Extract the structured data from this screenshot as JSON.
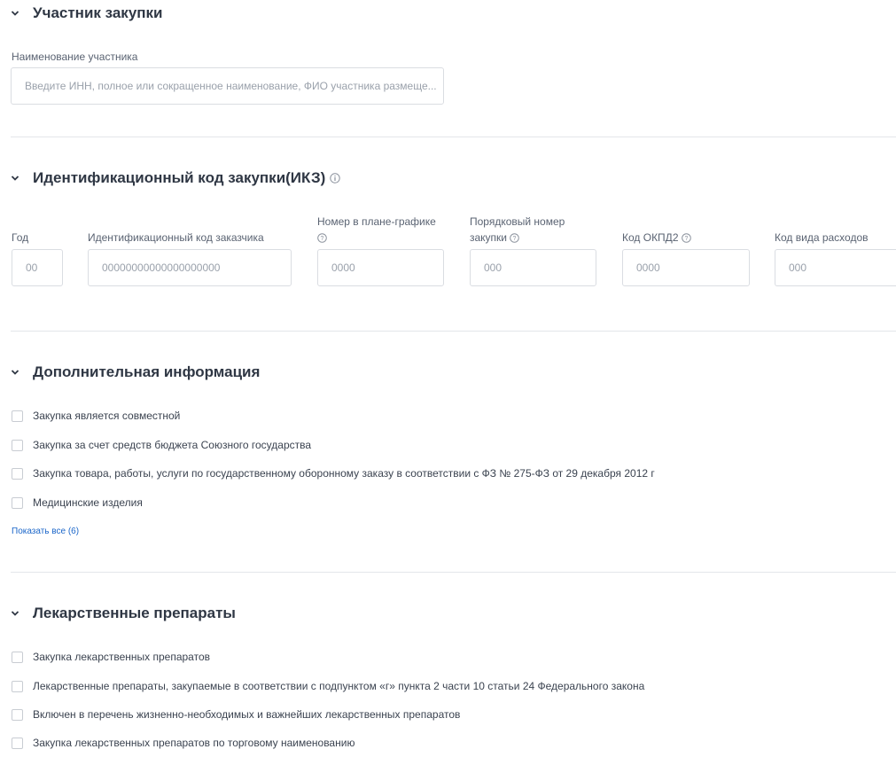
{
  "participant_section": {
    "title": "Участник закупки",
    "name_label": "Наименование участника",
    "name_placeholder": "Введите ИНН, полное или сокращенное наименование, ФИО участника размеще..."
  },
  "ikz_section": {
    "title": "Идентификационный код закупки(ИКЗ)",
    "fields": [
      {
        "label": "Год",
        "label_line2": "",
        "placeholder": "00"
      },
      {
        "label": "Идентификационный код заказчика",
        "label_line2": "",
        "placeholder": "00000000000000000000"
      },
      {
        "label": "Номер в плане-графике",
        "label_line2": "",
        "placeholder": "0000"
      },
      {
        "label": "Порядковый номер",
        "label_line2": "закупки",
        "placeholder": "000"
      },
      {
        "label": "Код ОКПД2",
        "label_line2": "",
        "placeholder": "0000"
      },
      {
        "label": "Код вида расходов",
        "label_line2": "",
        "placeholder": "000"
      }
    ]
  },
  "additional_section": {
    "title": "Дополнительная информация",
    "checkboxes": [
      "Закупка является совместной",
      "Закупка за счет средств бюджета Союзного государства",
      "Закупка товара, работы, услуги по государственному оборонному заказу в соответствии с ФЗ № 275-ФЗ от 29 декабря 2012 г",
      "Медицинские изделия"
    ],
    "show_all_label": "Показать все (6)"
  },
  "drugs_section": {
    "title": "Лекарственные препараты",
    "checkboxes": [
      "Закупка лекарственных препаратов",
      "Лекарственные препараты, закупаемые в соответствии с подпунктом «г» пункта 2 части 10 статьи 24 Федерального закона",
      "Включен в перечень жизненно-необходимых и важнейших лекарственных препаратов",
      "Закупка лекарственных препаратов по торговому наименованию"
    ]
  },
  "icons": {
    "chevron": "chevron-down-icon",
    "info": "info-circle-icon",
    "help": "question-circle-icon"
  },
  "colors": {
    "link": "#1b66c9",
    "title": "#2f3744",
    "border": "#dadde2"
  }
}
